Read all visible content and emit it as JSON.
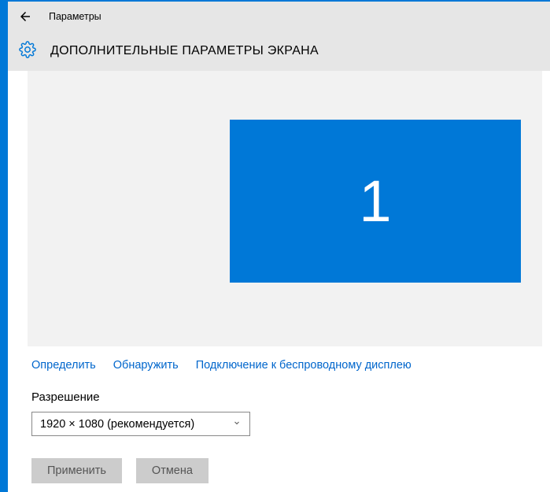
{
  "titlebar": {
    "back_label": "Назад",
    "title": "Параметры"
  },
  "header": {
    "title": "ДОПОЛНИТЕЛЬНЫЕ ПАРАМЕТРЫ ЭКРАНА"
  },
  "monitor": {
    "number": "1"
  },
  "links": {
    "identify": "Определить",
    "detect": "Обнаружить",
    "wireless": "Подключение к беспроводному дисплею"
  },
  "resolution": {
    "label": "Разрешение",
    "selected": "1920 × 1080 (рекомендуется)"
  },
  "buttons": {
    "apply": "Применить",
    "cancel": "Отмена"
  },
  "colors": {
    "accent": "#0078d7",
    "link": "#0066cc"
  }
}
